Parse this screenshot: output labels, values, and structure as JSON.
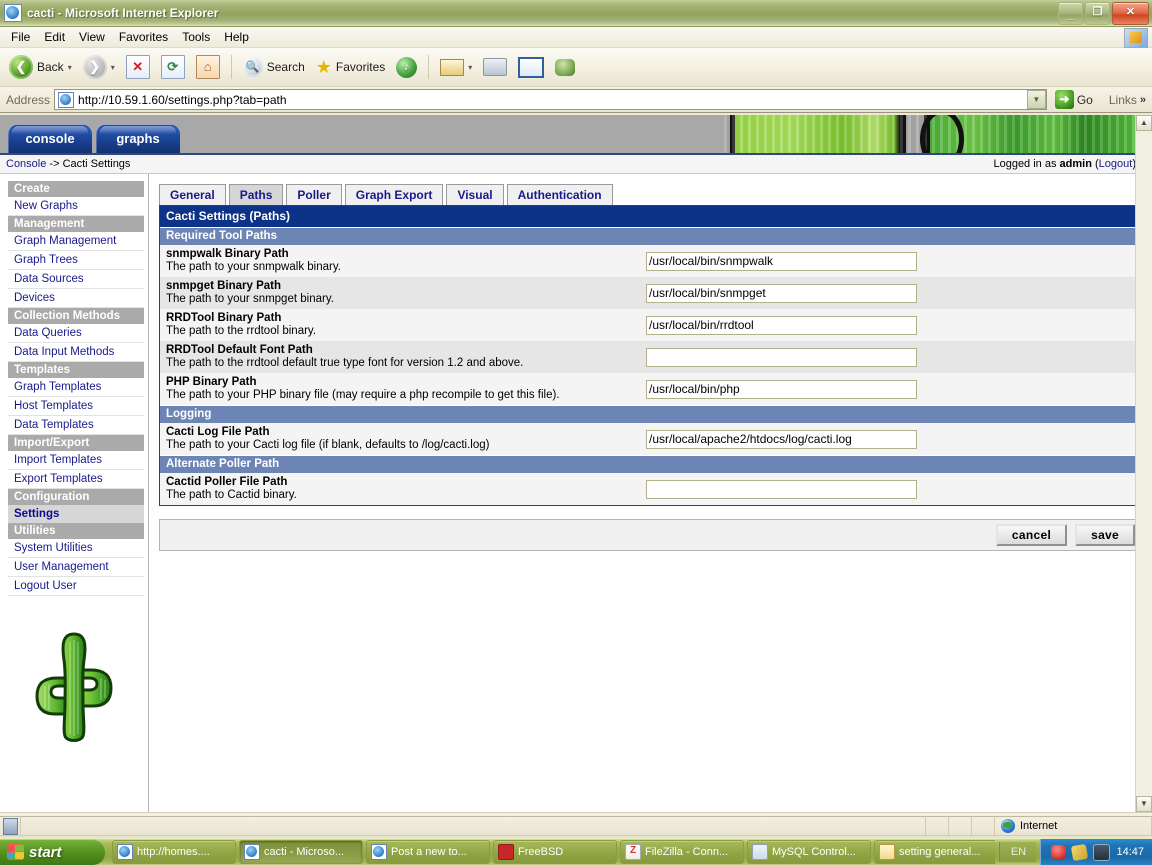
{
  "window": {
    "title": "cacti - Microsoft Internet Explorer",
    "icon": "ie-page-icon",
    "minimize": "_",
    "maximize": "❐",
    "close": "✕"
  },
  "menubar": {
    "items": [
      "File",
      "Edit",
      "View",
      "Favorites",
      "Tools",
      "Help"
    ],
    "brand_icon": "ie-brand-icon"
  },
  "toolbar": {
    "back": "Back",
    "forward_icon": "forward-icon",
    "stop_icon": "stop-icon",
    "refresh_icon": "refresh-icon",
    "home_icon": "home-icon",
    "search": "Search",
    "favorites": "Favorites",
    "media_icon": "media-icon",
    "mail_icon": "mail-icon",
    "print_icon": "print-icon",
    "edit_icon": "edit-icon",
    "messenger_icon": "messenger-icon",
    "dropdown_glyph": "▾"
  },
  "address": {
    "label": "Address",
    "url": "http://10.59.1.60/settings.php?tab=path",
    "dropdown_glyph": "▼",
    "go_label": "Go",
    "go_glyph": "➜",
    "links_label": "Links",
    "links_chevron": "»"
  },
  "cacti": {
    "top_tabs": [
      {
        "label": "console",
        "selected": true
      },
      {
        "label": "graphs",
        "selected": false
      }
    ],
    "breadcrumb": "Console -> Cacti Settings",
    "breadcrumb_console": "Console",
    "breadcrumb_sep": " -> ",
    "breadcrumb_page": "Cacti Settings",
    "login_prefix": "Logged in as ",
    "login_user": "admin",
    "logout_open": " (",
    "logout_label": "Logout",
    "logout_close": ")"
  },
  "sidebar": {
    "groups": [
      {
        "head": "Create",
        "items": [
          "New Graphs"
        ]
      },
      {
        "head": "Management",
        "items": [
          "Graph Management",
          "Graph Trees",
          "Data Sources",
          "Devices"
        ]
      },
      {
        "head": "Collection Methods",
        "items": [
          "Data Queries",
          "Data Input Methods"
        ]
      },
      {
        "head": "Templates",
        "items": [
          "Graph Templates",
          "Host Templates",
          "Data Templates"
        ]
      },
      {
        "head": "Import/Export",
        "items": [
          "Import Templates",
          "Export Templates"
        ]
      },
      {
        "head": "Configuration",
        "items": [
          "Settings"
        ]
      },
      {
        "head": "Utilities",
        "items": [
          "System Utilities",
          "User Management",
          "Logout User"
        ]
      }
    ],
    "selected_item": "Settings",
    "logo_icon": "cactus-logo"
  },
  "settings": {
    "tabs": [
      {
        "label": "General",
        "active": false
      },
      {
        "label": "Paths",
        "active": true
      },
      {
        "label": "Poller",
        "active": false
      },
      {
        "label": "Graph Export",
        "active": false
      },
      {
        "label": "Visual",
        "active": false
      },
      {
        "label": "Authentication",
        "active": false
      }
    ],
    "panel_title": "Cacti Settings (Paths)",
    "sections": [
      {
        "title": "Required Tool Paths",
        "rows": [
          {
            "label": "snmpwalk Binary Path",
            "description": "The path to your snmpwalk binary.",
            "value": "/usr/local/bin/snmpwalk"
          },
          {
            "label": "snmpget Binary Path",
            "description": "The path to your snmpget binary.",
            "value": "/usr/local/bin/snmpget"
          },
          {
            "label": "RRDTool Binary Path",
            "description": "The path to the rrdtool binary.",
            "value": "/usr/local/bin/rrdtool"
          },
          {
            "label": "RRDTool Default Font Path",
            "description": "The path to the rrdtool default true type font for version 1.2 and above.",
            "value": ""
          },
          {
            "label": "PHP Binary Path",
            "description": "The path to your PHP binary file (may require a php recompile to get this file).",
            "value": "/usr/local/bin/php"
          }
        ]
      },
      {
        "title": "Logging",
        "rows": [
          {
            "label": "Cacti Log File Path",
            "description": "The path to your Cacti log file (if blank, defaults to /log/cacti.log)",
            "value": "/usr/local/apache2/htdocs/log/cacti.log"
          }
        ]
      },
      {
        "title": "Alternate Poller Path",
        "rows": [
          {
            "label": "Cactid Poller File Path",
            "description": "The path to Cactid binary.",
            "value": ""
          }
        ]
      }
    ],
    "cancel_label": "cancel",
    "save_label": "save"
  },
  "statusbar": {
    "security_icon": "security-lock-icon",
    "zone_label": "Internet",
    "zone_icon": "globe-icon"
  },
  "taskbar": {
    "start_label": "start",
    "start_icon": "windows-flag-icon",
    "tasks": [
      {
        "label": "http://homes....",
        "icon": "ie",
        "active": false
      },
      {
        "label": "cacti - Microso...",
        "icon": "ie",
        "active": true
      },
      {
        "label": "Post a new to...",
        "icon": "ie",
        "active": false
      },
      {
        "label": "FreeBSD",
        "icon": "fbsd",
        "active": false
      },
      {
        "label": "FileZilla - Conn...",
        "icon": "fz",
        "active": false
      },
      {
        "label": "MySQL Control...",
        "icon": "mysql",
        "active": false
      },
      {
        "label": "setting general...",
        "icon": "doc",
        "active": false
      }
    ],
    "language": "EN",
    "tray_icons": [
      "shield-icon",
      "pencil-icon",
      "camera-icon"
    ],
    "clock": "14:47"
  },
  "colors": {
    "panel_title_bg": "#0d3389",
    "section_bar_bg": "#6d85b5",
    "link": "#19198c",
    "nav_head_bg": "#aaaaaa",
    "tab_active_bg": "#d6d6d6"
  }
}
